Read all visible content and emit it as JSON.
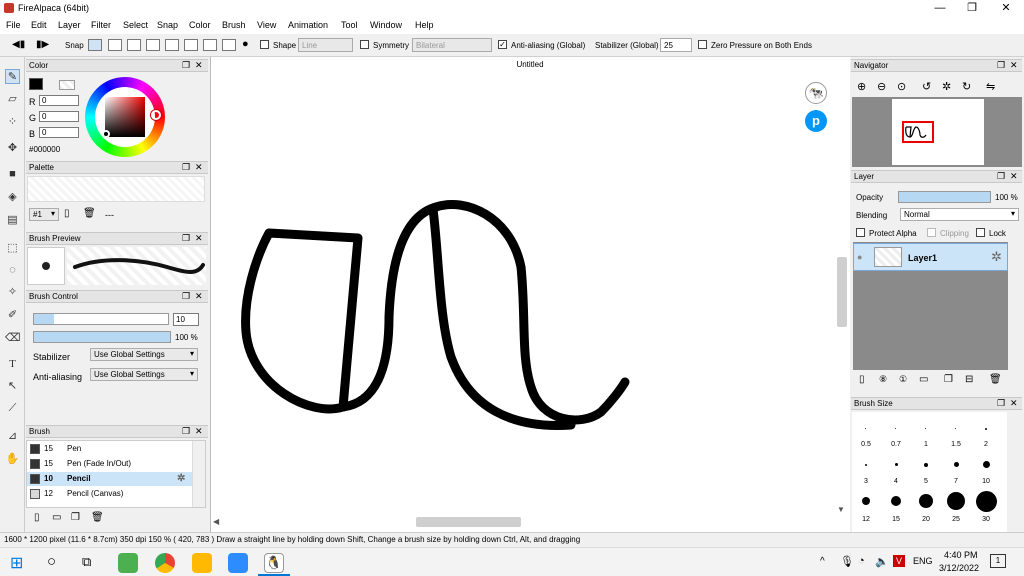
{
  "window": {
    "title": "FireAlpaca (64bit)",
    "minimize": "—",
    "restore": "❐",
    "close": "✕"
  },
  "menu": [
    "File",
    "Edit",
    "Layer",
    "Filter",
    "Select",
    "Snap",
    "Color",
    "Brush",
    "View",
    "Animation",
    "Tool",
    "Window",
    "Help"
  ],
  "toolbar": {
    "snap_label": "Snap",
    "shape_label": "Shape",
    "shape_value": "Line",
    "symmetry_label": "Symmetry",
    "symmetry_value": "Bilateral",
    "antialias_label": "Anti-aliasing (Global)",
    "antialias_checked": true,
    "stabilizer_label": "Stabilizer (Global)",
    "stabilizer_value": "25",
    "zero_pressure_label": "Zero Pressure on Both Ends"
  },
  "color_panel": {
    "title": "Color",
    "r_label": "R",
    "r_value": "0",
    "g_label": "G",
    "g_value": "0",
    "b_label": "B",
    "b_value": "0",
    "hex": "#000000"
  },
  "palette_panel": {
    "title": "Palette",
    "selector": "#1",
    "dash": "---"
  },
  "brush_preview_panel": {
    "title": "Brush Preview"
  },
  "brush_control_panel": {
    "title": "Brush Control",
    "size_value": "10",
    "size_fraction": 0.15,
    "opacity_label": "100 %",
    "opacity_fraction": 1.0,
    "stabilizer_label": "Stabilizer",
    "stabilizer_value": "Use Global Settings",
    "antialias_label": "Anti-aliasing",
    "antialias_value": "Use Global Settings"
  },
  "brush_panel": {
    "title": "Brush",
    "items": [
      {
        "size": "15",
        "name": "Pen",
        "color": "#333333"
      },
      {
        "size": "15",
        "name": "Pen (Fade In/Out)",
        "color": "#333333"
      },
      {
        "size": "10",
        "name": "Pencil",
        "color": "#333333",
        "selected": true
      },
      {
        "size": "12",
        "name": "Pencil (Canvas)",
        "color": "#d8d8d8"
      }
    ]
  },
  "canvas": {
    "tab_title": "Untitled"
  },
  "navigator_panel": {
    "title": "Navigator"
  },
  "layer_panel": {
    "title": "Layer",
    "opacity_label": "Opacity",
    "opacity_value": "100 %",
    "opacity_fraction": 1.0,
    "blending_label": "Blending",
    "blending_value": "Normal",
    "protect_alpha": "Protect Alpha",
    "clipping": "Clipping",
    "lock": "Lock",
    "layers": [
      {
        "name": "Layer1"
      }
    ]
  },
  "brush_size_panel": {
    "title": "Brush Size",
    "labels_row1": [
      "0.5",
      "0.7",
      "1",
      "1.5",
      "2"
    ],
    "labels_row2": [
      "3",
      "4",
      "5",
      "7",
      "10"
    ],
    "labels_row3": [
      "12",
      "15",
      "20",
      "25",
      "30"
    ]
  },
  "status": {
    "text": "1600 * 1200 pixel   (11.6 * 8.7cm)   350 dpi   150 %   ( 420, 783 )   Draw a straight line by holding down Shift, Change a brush size by holding down Ctrl, Alt, and dragging"
  },
  "taskbar": {
    "time": "4:40 PM",
    "date": "3/12/2022",
    "lang": "ENG",
    "notif_count": "1"
  },
  "colors": {
    "accent": "#cce4f7",
    "selection": "#b7d8f2",
    "taskbar": "#f3f3f3"
  }
}
